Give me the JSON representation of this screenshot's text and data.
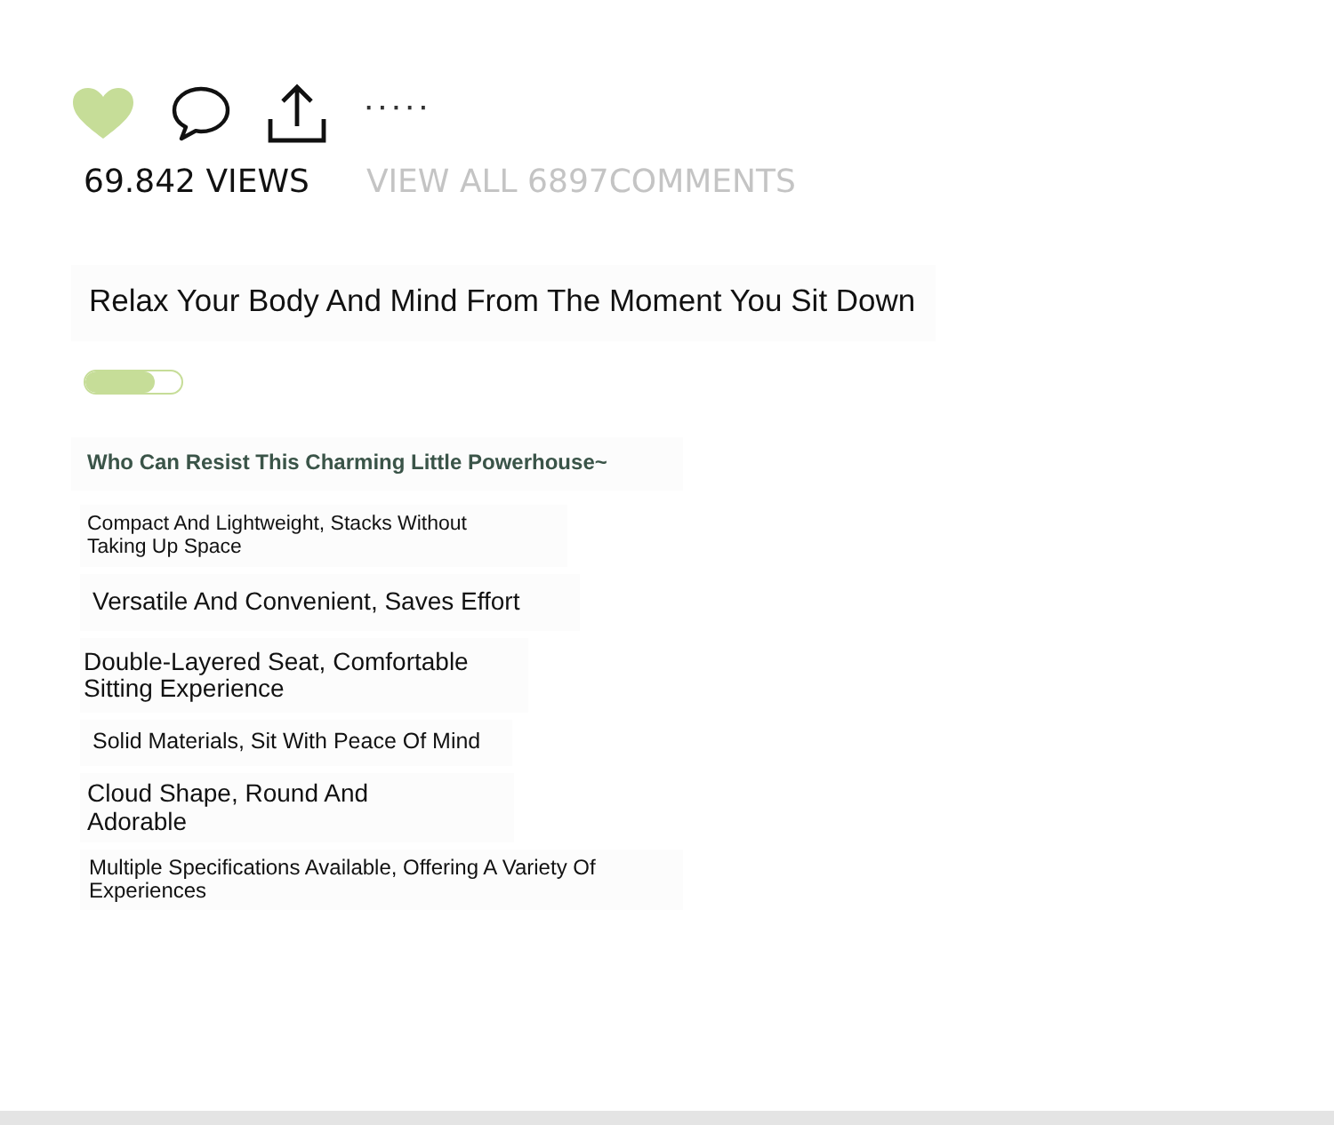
{
  "actions": {
    "liked": true,
    "more": "·····"
  },
  "stats": {
    "views": "69.842 VIEWS",
    "comments_link": "VIEW ALL 6897COMMENTS"
  },
  "headline": "Relax Your Body And Mind From The Moment You Sit Down",
  "progress": {
    "level": 0.72
  },
  "tagline": "Who Can Resist This Charming Little Powerhouse~",
  "features": [
    {
      "text": "Compact And Lightweight, Stacks Without Taking Up Space"
    },
    {
      "text": "Versatile And Convenient, Saves Effort"
    },
    {
      "text": "Double-Layered Seat, Comfortable Sitting Experience"
    },
    {
      "text": "Solid Materials, Sit With Peace Of Mind"
    },
    {
      "text": "Cloud Shape, Round And Adorable"
    },
    {
      "text": "Multiple Specifications Available, Offering A Variety Of Experiences"
    }
  ]
}
